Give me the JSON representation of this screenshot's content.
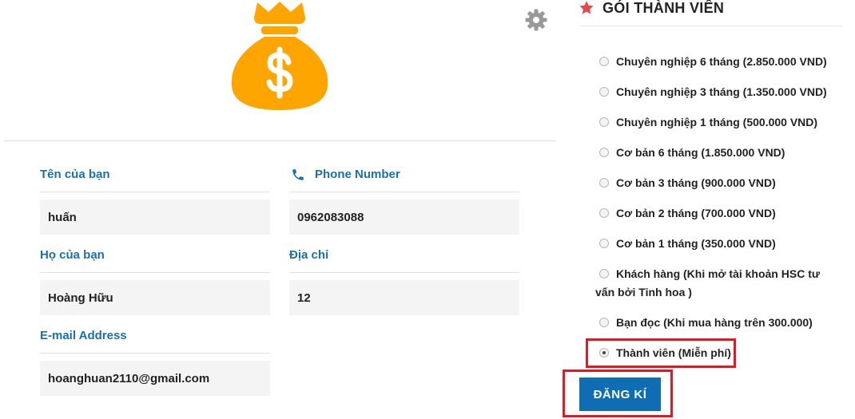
{
  "header": {
    "logo_icon": "money-bag-icon",
    "settings_icon": "gear-icon",
    "colors": {
      "logo": "#FFA500",
      "gear": "#999999"
    }
  },
  "form": {
    "first_name": {
      "label": "Tên của bạn",
      "value": "huấn"
    },
    "phone": {
      "label": "Phone Number",
      "icon": "phone-icon",
      "value": "0962083088"
    },
    "last_name": {
      "label": "Họ của bạn",
      "value": "Hoàng Hữu"
    },
    "address": {
      "label": "Địa chỉ",
      "value": "12"
    },
    "email": {
      "label": "E-mail Address",
      "value": "hoanghuan2110@gmail.com"
    },
    "label_color": "#1A6FAE"
  },
  "membership": {
    "title": "GÓI THÀNH VIÊN",
    "title_icon": "star-icon",
    "options": [
      {
        "label": "Chuyên nghiệp 6 tháng (2.850.000 VND)",
        "selected": false
      },
      {
        "label": "Chuyên nghiệp 3 tháng (1.350.000 VND)",
        "selected": false
      },
      {
        "label": "Chuyên nghiệp 1 tháng (500.000 VND)",
        "selected": false
      },
      {
        "label": "Cơ bản 6 tháng (1.850.000 VND)",
        "selected": false
      },
      {
        "label": "Cơ bản 3 tháng (900.000 VND)",
        "selected": false
      },
      {
        "label": "Cơ bản 2 tháng (700.000 VND)",
        "selected": false
      },
      {
        "label": "Cơ bản 1 tháng (350.000 VND)",
        "selected": false
      },
      {
        "label": "Khách hàng (Khi mở tài khoản HSC tư vấn bởi Tinh hoa )",
        "selected": false
      },
      {
        "label": "Bạn đọc (Khi mua hàng trên 300.000)",
        "selected": false
      },
      {
        "label": "Thành viên (Miễn phí)",
        "selected": true
      }
    ],
    "submit_label": "ĐĂNG KÍ",
    "colors": {
      "button": "#0F6DB3",
      "highlight": "#E01A22",
      "star": "#E8484D"
    }
  }
}
